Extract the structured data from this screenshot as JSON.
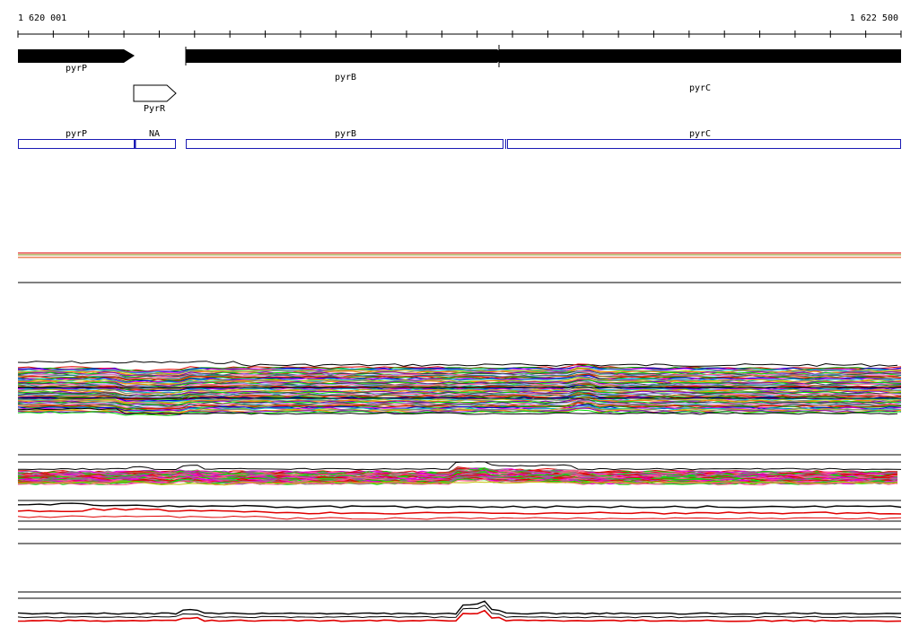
{
  "ruler": {
    "start_label": "1 620 001",
    "end_label": "1 622 500"
  },
  "genes": [
    {
      "name": "pyrP",
      "strand": "+",
      "style": "solid"
    },
    {
      "name": "PyrR",
      "strand": "+",
      "style": "outline"
    },
    {
      "name": "pyrB",
      "strand": "+",
      "style": "solid"
    },
    {
      "name": "pyrC",
      "strand": "+",
      "style": "solid"
    }
  ],
  "segments": [
    {
      "label": "pyrP"
    },
    {
      "label": "NA"
    },
    {
      "label": "pyrB"
    },
    {
      "label": "pyrC"
    }
  ],
  "colors": {
    "gene_fill": "#000000",
    "segment_stroke": "#1a1ab4",
    "track_red": "#e00000",
    "track_black": "#000000",
    "palette": [
      "#e00000",
      "#00a000",
      "#0000e0",
      "#e000e0",
      "#00c0c0",
      "#c0c000",
      "#808080",
      "#ff8000",
      "#8000c0",
      "#00e000",
      "#404040",
      "#a0a0ff",
      "#ff6090",
      "#008080",
      "#c06000"
    ]
  }
}
